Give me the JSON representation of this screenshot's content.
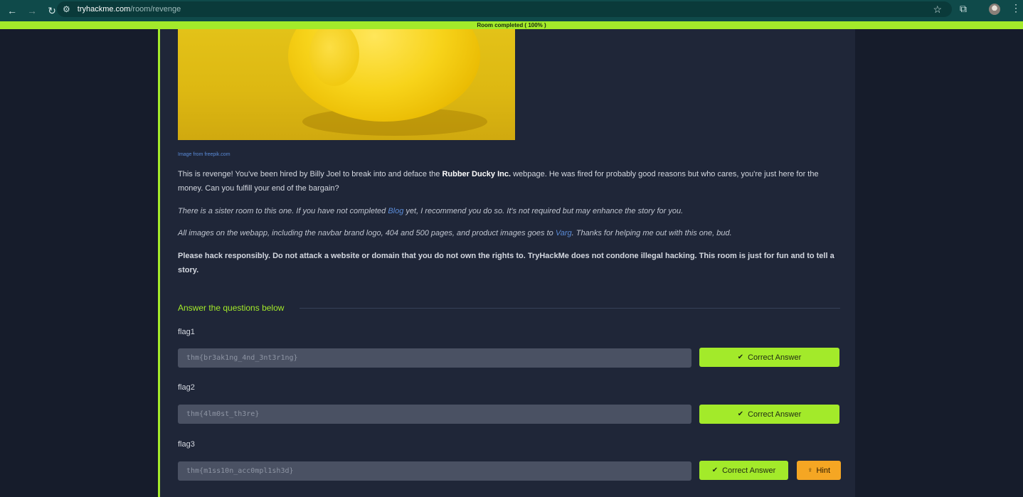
{
  "browser": {
    "url_host": "tryhackme.com",
    "url_path": "/room/revenge"
  },
  "progress": {
    "label": "Room completed ( 100% )",
    "percent": 100,
    "color": "#a3ea2a"
  },
  "content": {
    "image_credit": "Image from freepik.com",
    "intro_pre": "This is revenge! You've been hired by Billy Joel to break into and deface the ",
    "intro_bold": "Rubber Ducky Inc.",
    "intro_post": " webpage. He was fired for probably good reasons but who cares, you're just here for the money. Can you fulfill your end of the bargain?",
    "sister_pre": "There is a sister room to this one. If you have not completed ",
    "sister_link": "Blog",
    "sister_post": " yet, I recommend you do so. It's not required but may enhance the story for you.",
    "images_pre": "All images on the webapp, including the navbar brand logo, 404 and 500 pages, and product images goes to ",
    "images_link": "Varg",
    "images_post": ". Thanks for helping me out with this one, bud.",
    "warning": "Please hack responsibly. Do not attack a website or domain that you do not own the rights to. TryHackMe does not condone illegal hacking. This room is just for fun and to tell a story."
  },
  "answers": {
    "heading": "Answer the questions below",
    "questions": [
      {
        "label": "flag1",
        "value": "thm{br3ak1ng_4nd_3nt3r1ng}",
        "button": "Correct Answer"
      },
      {
        "label": "flag2",
        "value": "thm{4lm0st_th3re}",
        "button": "Correct Answer"
      },
      {
        "label": "flag3",
        "value": "thm{m1ss10n_acc0mpl1sh3d}",
        "button": "Correct Answer",
        "hint": "Hint"
      }
    ]
  },
  "colors": {
    "accent": "#a3ea2a",
    "panel": "#1f2638",
    "hint": "#f5a623",
    "link": "#5a8bd8"
  }
}
